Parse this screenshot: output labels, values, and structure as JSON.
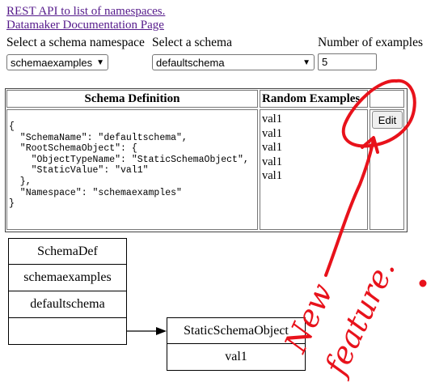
{
  "links": {
    "rest_api": "REST API to list of namespaces.",
    "docs": "Datamaker Documentation Page"
  },
  "form": {
    "namespace_label": "Select a schema namespace",
    "schema_label": "Select a schema",
    "examples_label": "Number of examples",
    "namespace_value": "schemaexamples",
    "schema_value": "defaultschema",
    "examples_value": "5"
  },
  "table": {
    "col_definition": "Schema Definition",
    "col_examples": "Random Examples",
    "definition_json": "{\n  \"SchemaName\": \"defaultschema\",\n  \"RootSchemaObject\": {\n    \"ObjectTypeName\": \"StaticSchemaObject\",\n    \"StaticValue\": \"val1\"\n  },\n  \"Namespace\": \"schemaexamples\"\n}",
    "examples": [
      "val1",
      "val1",
      "val1",
      "val1",
      "val1"
    ],
    "edit_label": "Edit"
  },
  "diagram": {
    "schema_box": [
      "SchemaDef",
      "schemaexamples",
      "defaultschema",
      ""
    ],
    "object_box": [
      "StaticSchemaObject",
      "val1"
    ]
  },
  "annotation": {
    "text_line1": "New",
    "text_line2": "feature.",
    "color": "#e8121b"
  }
}
